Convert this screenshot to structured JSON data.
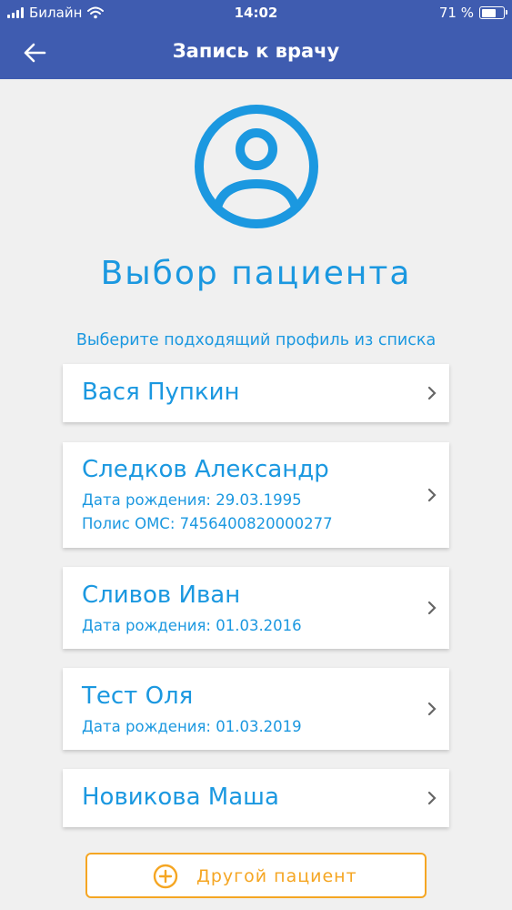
{
  "status_bar": {
    "carrier": "Билайн",
    "time": "14:02",
    "battery_text": "71 %",
    "battery_level": 0.71
  },
  "header": {
    "title": "Запись к врачу"
  },
  "page": {
    "title": "Выбор пациента",
    "subtitle": "Выберите подходящий профиль из списка"
  },
  "patients": [
    {
      "name": "Вася Пупкин"
    },
    {
      "name": "Следков Александр",
      "birth": "Дата рождения: 29.03.1995",
      "policy": "Полис ОМС: 7456400820000277"
    },
    {
      "name": "Сливов Иван",
      "birth": "Дата рождения: 01.03.2016"
    },
    {
      "name": "Тест Оля",
      "birth": "Дата рождения: 01.03.2019"
    },
    {
      "name": "Новикова Маша"
    }
  ],
  "actions": {
    "other_patient": "Другой пациент"
  },
  "colors": {
    "header": "#3f5cb0",
    "accent": "#1b98e0",
    "orange": "#f5a623",
    "background": "#f0f0f0"
  },
  "icons": [
    "signal-icon",
    "wifi-icon",
    "battery-icon",
    "back-arrow-icon",
    "user-circle-icon",
    "chevron-right-icon",
    "plus-circle-icon"
  ]
}
